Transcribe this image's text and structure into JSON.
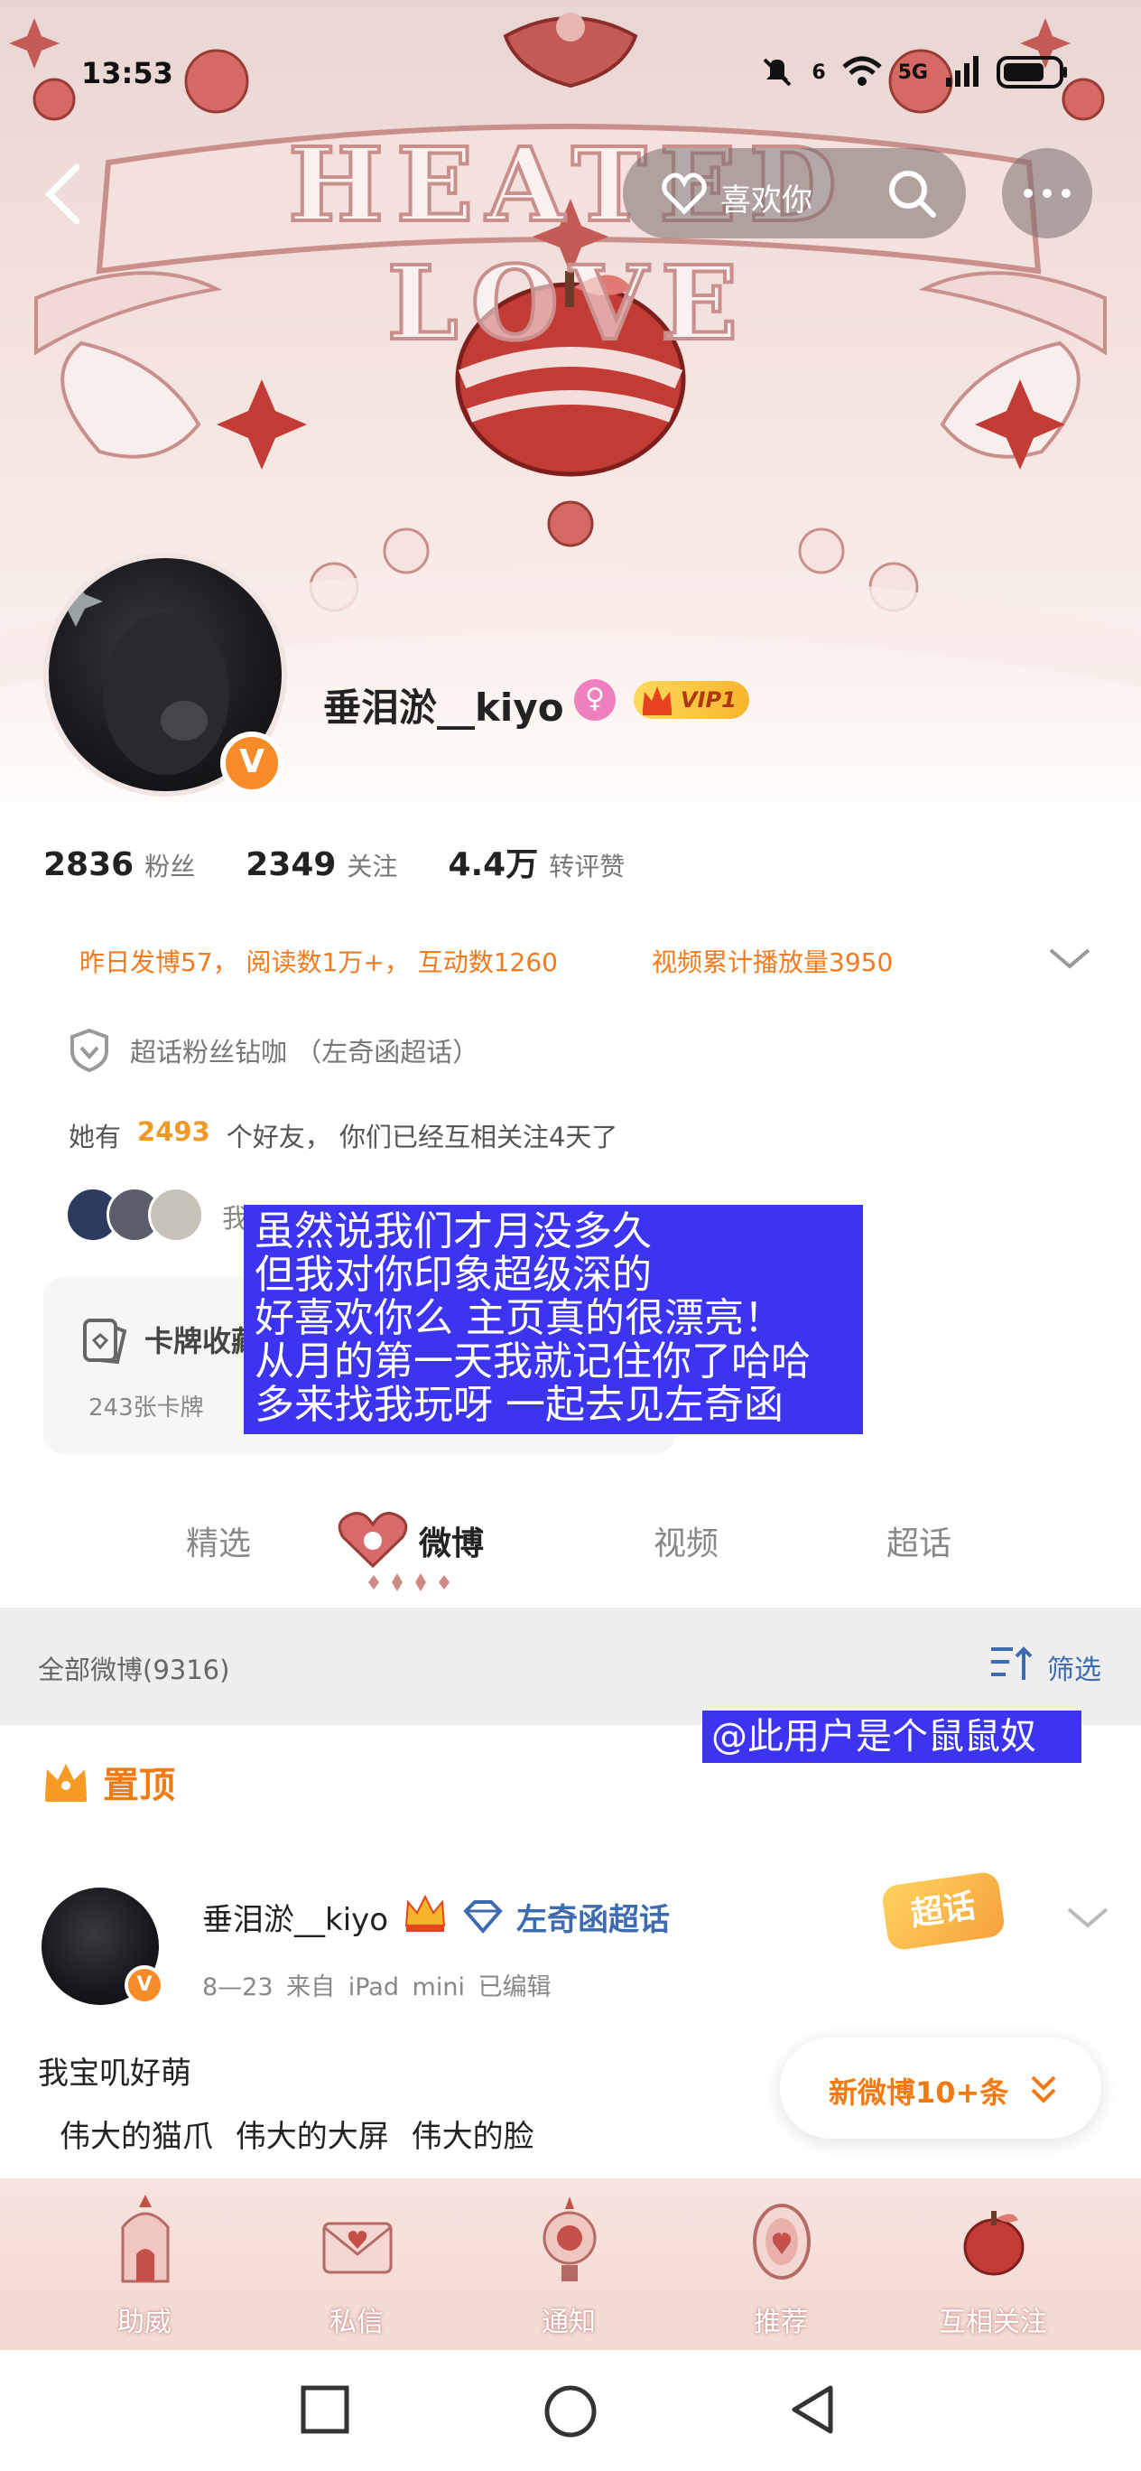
{
  "status_bar": {
    "time": "13:53",
    "network": "5G",
    "signal_small": "6"
  },
  "banner": {
    "title": "HEATED LOVE"
  },
  "top_nav": {
    "like_label": "喜欢你"
  },
  "profile": {
    "name": "垂泪淤__kiyo",
    "vip_label": "VIP1",
    "avatar_badge": "V",
    "stats": [
      {
        "num": "2836",
        "label": "粉丝"
      },
      {
        "num": "2349",
        "label": "关注"
      },
      {
        "num": "4.4万",
        "label": "转评赞"
      }
    ],
    "activity": "昨日发博57， 阅读数1万+， 互动数1260",
    "activity_video": "视频累计播放量3950",
    "chaohua": "超话粉丝钻咖 （左奇函超话）",
    "friends_prefix": "她有",
    "friends_count": "2493",
    "friends_suffix": "个好友， 你们已经互相关注4天了",
    "mutual_text": "我的…",
    "card_title": "卡牌收藏",
    "card_sub": "243张卡牌"
  },
  "caption": {
    "lines": [
      "虽然说我们才月没多久",
      "但我对你印象超级深的",
      "好喜欢你么 主页真的很漂亮！",
      "从月的第一天我就记住你了哈哈",
      "多来找我玩呀 一起去见左奇函"
    ],
    "tag": "@此用户是个鼠鼠奴"
  },
  "tabs": {
    "items": [
      "精选",
      "微博",
      "视频",
      "超话"
    ],
    "active": "微博"
  },
  "filter_bar": {
    "all_label": "全部微博(9316)",
    "filter_label": "筛选"
  },
  "pinned": {
    "label": "置顶"
  },
  "post": {
    "author": "垂泪淤__kiyo",
    "topic": "左奇函超话",
    "meta": "8—23  来自 iPad mini  已编辑",
    "chaohua_badge": "超话",
    "text_1": "我宝叽好萌",
    "text_2": "伟大的猫爪 伟大的大屏 伟大的脸",
    "new_posts_label": "新微博10+条"
  },
  "bottom_nav": {
    "items": [
      {
        "label": "助威",
        "icon": "castle-icon"
      },
      {
        "label": "私信",
        "icon": "letter-icon"
      },
      {
        "label": "通知",
        "icon": "lamp-icon"
      },
      {
        "label": "推荐",
        "icon": "mirror-icon"
      },
      {
        "label": "互相关注",
        "icon": "apple-icon"
      }
    ]
  },
  "colors": {
    "accent_orange": "#f27a12",
    "link_blue": "#3d6bb0",
    "caption_bg": "#3d34f2",
    "banner_red": "#b8423f"
  }
}
